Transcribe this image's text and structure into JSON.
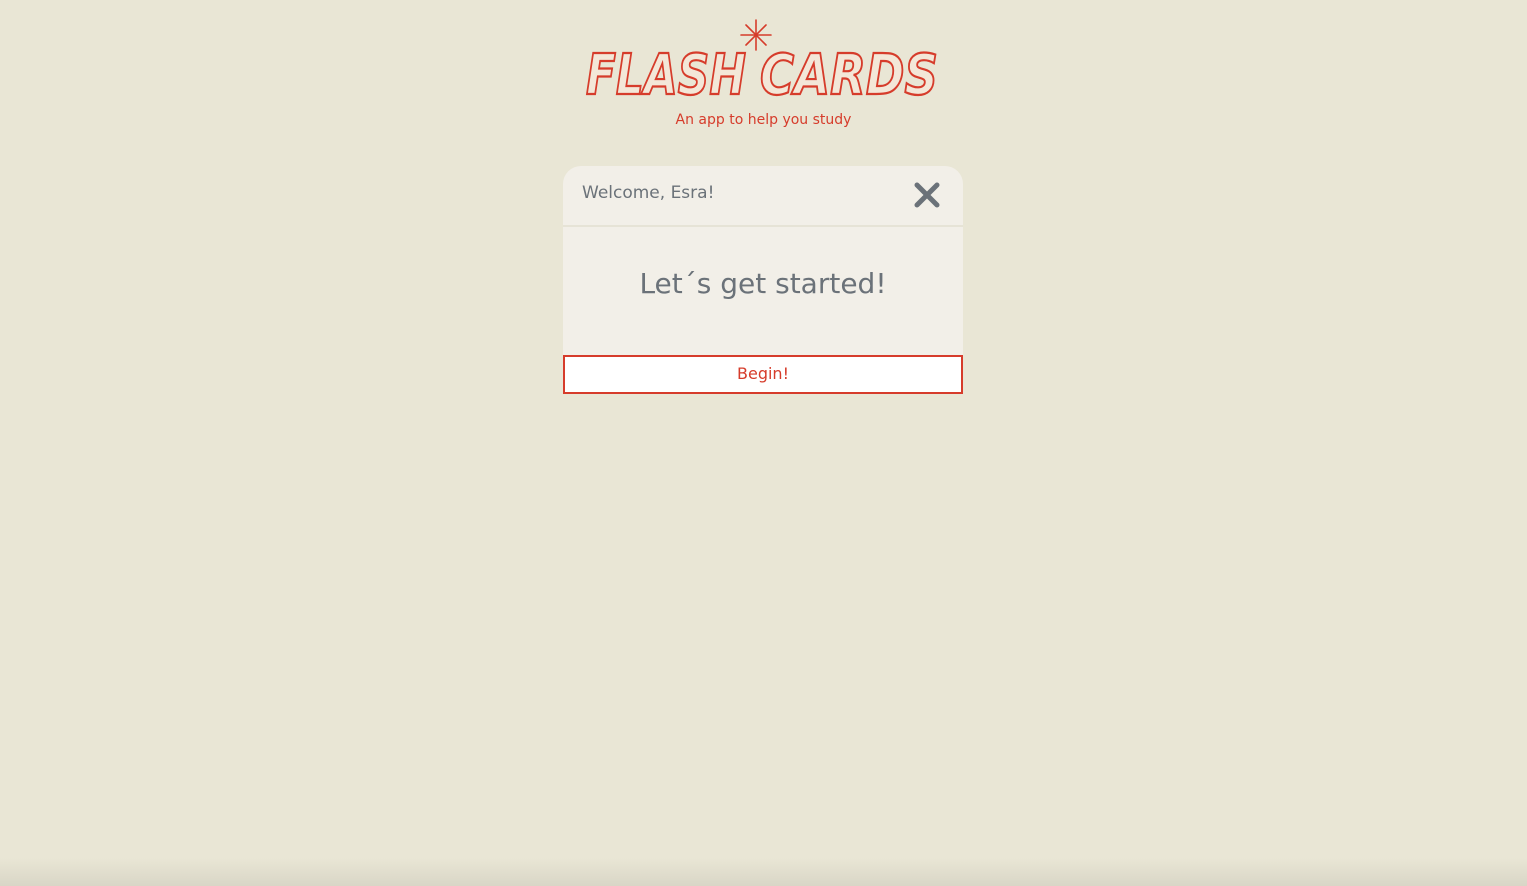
{
  "header": {
    "logo_text": "FLASH CARDS",
    "tagline": "An app to help you study"
  },
  "modal": {
    "title": "Welcome, Esra!",
    "close_icon": "close-icon",
    "body_text": "Let´s get started!",
    "begin_label": "Begin!"
  },
  "colors": {
    "brand": "#d63c2b",
    "background": "#e9e6d5",
    "panel": "#f2efe8",
    "text_muted": "#6b7279"
  }
}
